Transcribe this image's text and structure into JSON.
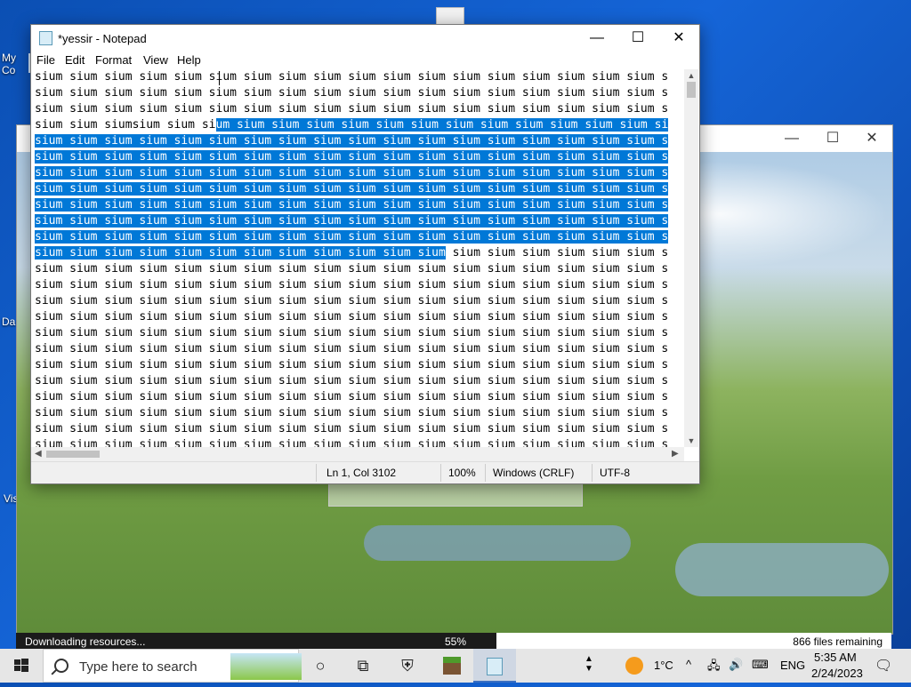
{
  "desktop": {
    "icons": [
      {
        "label": "My Co"
      },
      {
        "label": "Da"
      },
      {
        "label": "Vis"
      }
    ]
  },
  "background_window": {
    "controls": {
      "minimize": "—",
      "maximize": "☐",
      "close": "✕"
    }
  },
  "launcher_status": {
    "download_label": "Downloading resources...",
    "download_percent": "55%",
    "progress": 0.55,
    "files_remaining": "866 files remaining"
  },
  "notepad": {
    "title": "*yessir - Notepad",
    "menu": [
      "File",
      "Edit",
      "Format",
      "View",
      "Help"
    ],
    "lines": [
      {
        "pre": "sium sium sium sium sium sium sium sium sium sium sium sium sium sium sium sium sium sium s",
        "sel": "",
        "post": ""
      },
      {
        "pre": "sium sium sium sium sium sium sium sium sium sium sium sium sium sium sium sium sium sium s",
        "sel": "",
        "post": ""
      },
      {
        "pre": "sium sium sium sium sium sium sium sium sium sium sium sium sium sium sium sium sium sium s",
        "sel": "",
        "post": ""
      },
      {
        "pre": "sium sium siumsium sium si",
        "sel": "um sium sium sium sium sium sium sium sium sium sium sium sium si",
        "post": ""
      },
      {
        "pre": "",
        "sel": "sium sium sium sium sium sium sium sium sium sium sium sium sium sium sium sium sium sium s",
        "post": ""
      },
      {
        "pre": "",
        "sel": "sium sium sium sium sium sium sium sium sium sium sium sium sium sium sium sium sium sium s",
        "post": ""
      },
      {
        "pre": "",
        "sel": "sium sium sium sium sium sium sium sium sium sium sium sium sium sium sium sium sium sium s",
        "post": ""
      },
      {
        "pre": "",
        "sel": "sium sium sium sium sium sium sium sium sium sium sium sium sium sium sium sium sium sium s",
        "post": ""
      },
      {
        "pre": "",
        "sel": "sium sium sium sium sium sium sium sium sium sium sium sium sium sium sium sium sium sium s",
        "post": ""
      },
      {
        "pre": "",
        "sel": "sium sium sium sium sium sium sium sium sium sium sium sium sium sium sium sium sium sium s",
        "post": ""
      },
      {
        "pre": "",
        "sel": "sium sium sium sium sium sium sium sium sium sium sium sium sium sium sium sium sium sium s",
        "post": ""
      },
      {
        "pre": "",
        "sel": "sium sium sium sium sium sium sium sium sium sium sium sium",
        "post": " sium sium sium sium sium sium s"
      },
      {
        "pre": "sium sium sium sium sium sium sium sium sium sium sium sium sium sium sium sium sium sium s",
        "sel": "",
        "post": ""
      },
      {
        "pre": "sium sium sium sium sium sium sium sium sium sium sium sium sium sium sium sium sium sium s",
        "sel": "",
        "post": ""
      },
      {
        "pre": "sium sium sium sium sium sium sium sium sium sium sium sium sium sium sium sium sium sium s",
        "sel": "",
        "post": ""
      },
      {
        "pre": "sium sium sium sium sium sium sium sium sium sium sium sium sium sium sium sium sium sium s",
        "sel": "",
        "post": ""
      },
      {
        "pre": "sium sium sium sium sium sium sium sium sium sium sium sium sium sium sium sium sium sium s",
        "sel": "",
        "post": ""
      },
      {
        "pre": "sium sium sium sium sium sium sium sium sium sium sium sium sium sium sium sium sium sium s",
        "sel": "",
        "post": ""
      },
      {
        "pre": "sium sium sium sium sium sium sium sium sium sium sium sium sium sium sium sium sium sium s",
        "sel": "",
        "post": ""
      },
      {
        "pre": "sium sium sium sium sium sium sium sium sium sium sium sium sium sium sium sium sium sium s",
        "sel": "",
        "post": ""
      },
      {
        "pre": "sium sium sium sium sium sium sium sium sium sium sium sium sium sium sium sium sium sium s",
        "sel": "",
        "post": ""
      },
      {
        "pre": "sium sium sium sium sium sium sium sium sium sium sium sium sium sium sium sium sium sium s",
        "sel": "",
        "post": ""
      },
      {
        "pre": "sium sium sium sium sium sium sium sium sium sium sium sium sium sium sium sium sium sium s",
        "sel": "",
        "post": ""
      },
      {
        "pre": "sium sium sium sium sium sium sium sium sium sium sium sium sium sium sium sium sium sium s",
        "sel": "",
        "post": ""
      }
    ],
    "status": {
      "position": "Ln 1, Col 3102",
      "zoom": "100%",
      "line_ending": "Windows (CRLF)",
      "encoding": "UTF-8"
    },
    "selection_color": "#0078d7"
  },
  "taskbar": {
    "search_placeholder": "Type here to search",
    "task_view_icon": "task-view-icon",
    "tray": {
      "temperature": "1°C",
      "language": "ENG",
      "time": "5:35 AM",
      "date": "2/24/2023"
    }
  }
}
